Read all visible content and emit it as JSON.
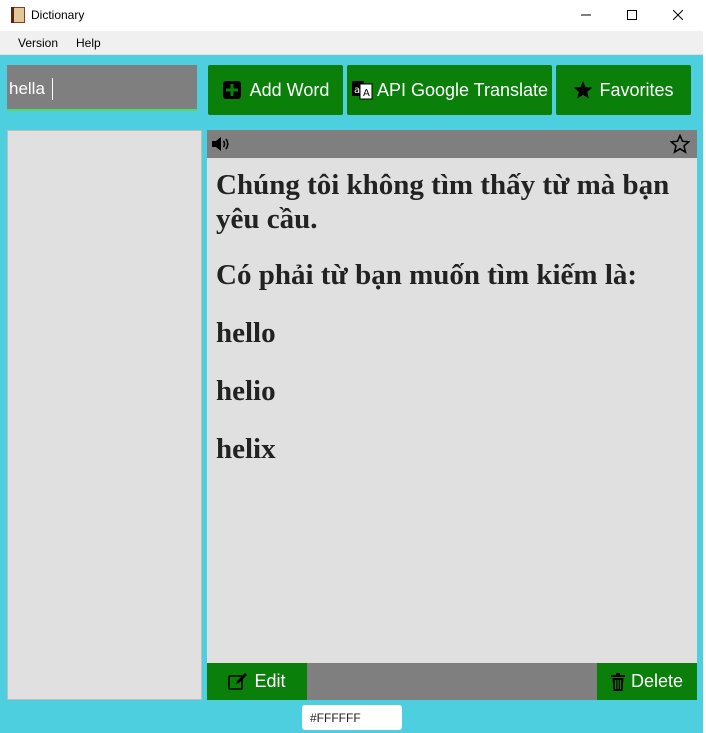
{
  "window": {
    "title": "Dictionary",
    "controls": {
      "minimize": "minimize",
      "maximize": "maximize",
      "close": "close"
    }
  },
  "menu": {
    "items": [
      "Version",
      "Help"
    ]
  },
  "search": {
    "value": "hella",
    "placeholder": ""
  },
  "toolbar": {
    "add_word_label": "Add Word",
    "api_label": "API Google Translate",
    "favorites_label": "Favorites"
  },
  "result": {
    "message": "Chúng tôi không tìm thấy từ mà bạn yêu cầu.",
    "question": "Có phải từ bạn muốn tìm kiếm là:",
    "suggestions": [
      "hello",
      "helio",
      "helix"
    ]
  },
  "actions": {
    "edit_label": "Edit",
    "delete_label": "Delete"
  },
  "color_picker": {
    "value": "#FFFFFF"
  },
  "colors": {
    "background": "#4ecfdf",
    "button": "#0a7f0a",
    "panel": "#e0e0e0",
    "header": "#7f7f7f",
    "search_underline": "#53d86a"
  },
  "icons": {
    "app": "book-icon",
    "add": "plus-square-icon",
    "api": "translate-icon",
    "favorites": "star-icon",
    "speaker": "speaker-icon",
    "favorite_toggle": "star-outline-icon",
    "edit": "edit-icon",
    "delete": "trash-icon"
  }
}
